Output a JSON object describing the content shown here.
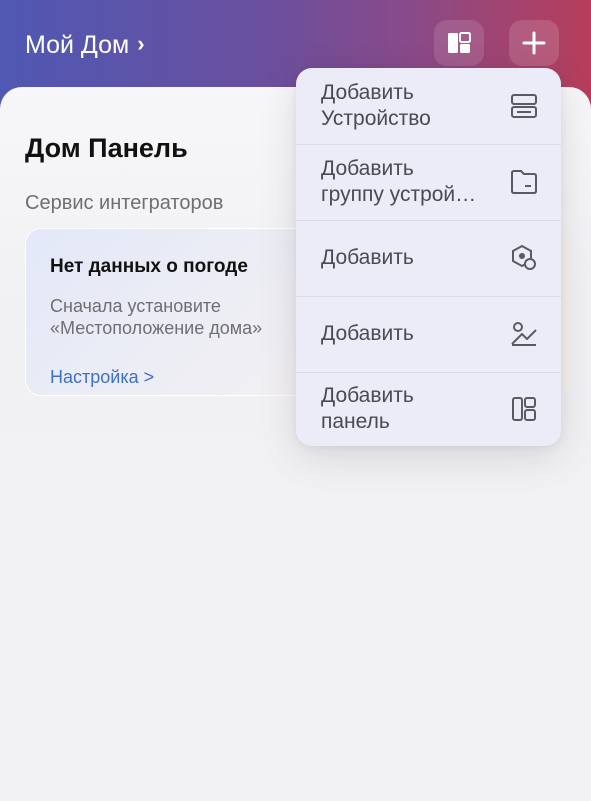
{
  "header": {
    "home_title": "Мой Дом",
    "colors": {
      "gradient_start": "#4f58b3",
      "gradient_end": "#b73e5a"
    }
  },
  "main": {
    "page_title": "Дом Панель",
    "section_label": "Сервис интеграторов",
    "weather_card": {
      "title": "Нет данных о погоде",
      "description": "Сначала установите «Местоположение дома»",
      "link": "Настройка >"
    }
  },
  "add_menu": {
    "items": [
      {
        "label": "Добавить\nУстройство",
        "icon": "device-icon"
      },
      {
        "label": "Добавить\nгруппу устрой…",
        "icon": "folder-icon"
      },
      {
        "label": "Добавить",
        "icon": "hexagon-icon"
      },
      {
        "label": "Добавить",
        "icon": "scene-icon"
      },
      {
        "label": "Добавить\nпанель",
        "icon": "panel-icon"
      }
    ]
  }
}
